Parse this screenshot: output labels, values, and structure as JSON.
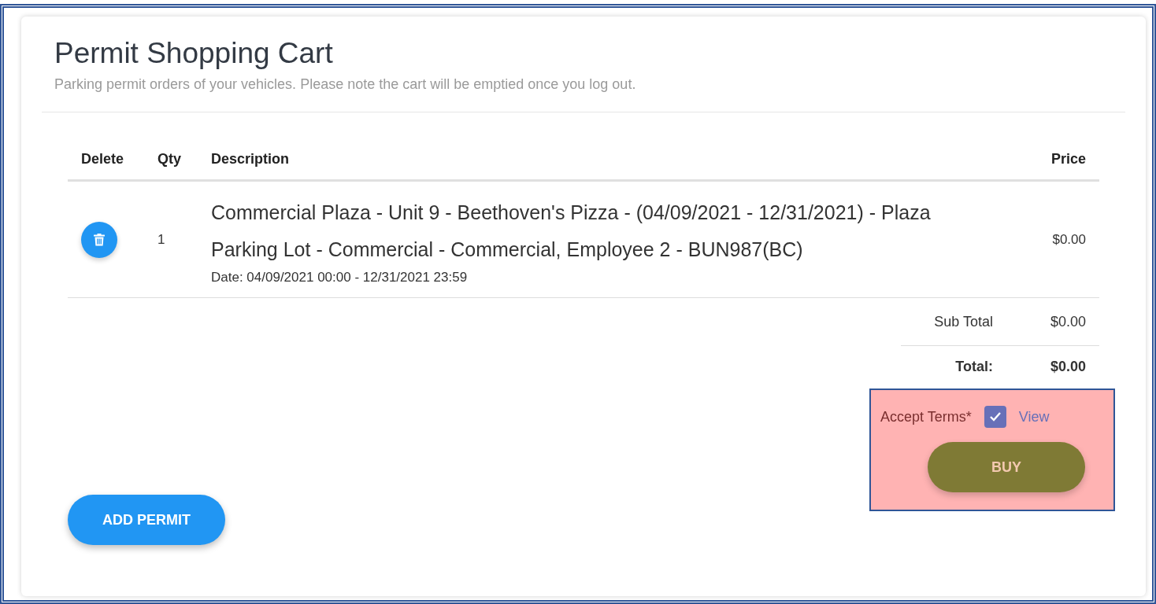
{
  "header": {
    "title": "Permit Shopping Cart",
    "subtitle": "Parking permit orders of your vehicles. Please note the cart will be emptied once you log out."
  },
  "table": {
    "columns": [
      "Delete",
      "Qty",
      "Description",
      "Price"
    ],
    "rows": [
      {
        "qty": "1",
        "description": "Commercial Plaza - Unit 9 - Beethoven's Pizza - (04/09/2021 - 12/31/2021) - Plaza Parking Lot - Commercial - Commercial, Employee 2 - BUN987(BC)",
        "date": "Date: 04/09/2021 00:00 - 12/31/2021 23:59",
        "price": "$0.00"
      }
    ]
  },
  "totals": [
    {
      "label": "Sub Total",
      "value": "$0.00",
      "kind": "subtotal"
    },
    {
      "label": "Total:",
      "value": "$0.00",
      "kind": "total"
    }
  ],
  "terms": {
    "label": "Accept Terms*",
    "checked": true,
    "link": "View"
  },
  "buy_button": "BUY",
  "add_button": "ADD PERMIT"
}
